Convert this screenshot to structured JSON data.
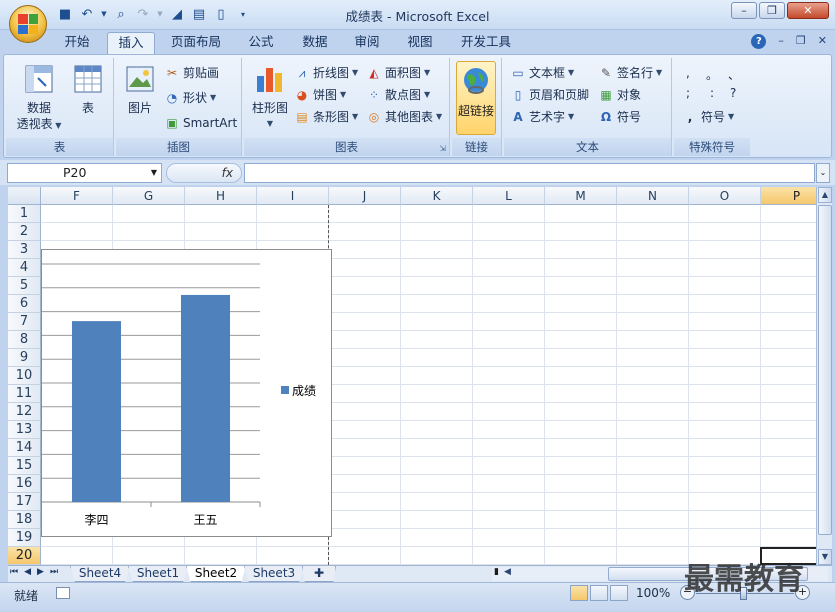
{
  "window": {
    "title": "成绩表 - Microsoft Excel"
  },
  "tabs": [
    "开始",
    "插入",
    "页面布局",
    "公式",
    "数据",
    "审阅",
    "视图",
    "开发工具"
  ],
  "active_tab": "插入",
  "ribbon": {
    "tables": {
      "label": "表",
      "pivot_line1": "数据",
      "pivot_line2": "透视表",
      "table": "表"
    },
    "illustrations": {
      "label": "插图",
      "picture": "图片",
      "clipart": "剪贴画",
      "shapes": "形状",
      "smartart": "SmartArt"
    },
    "charts": {
      "label": "图表",
      "column": "柱形图",
      "line": "折线图",
      "pie": "饼图",
      "bar": "条形图",
      "area": "面积图",
      "scatter": "散点图",
      "other": "其他图表"
    },
    "links": {
      "label": "链接",
      "hyperlink": "超链接"
    },
    "text": {
      "label": "文本",
      "textbox": "文本框",
      "header_footer": "页眉和页脚",
      "wordart": "艺术字",
      "signature": "签名行",
      "object": "对象",
      "symbol": "符号"
    },
    "special": {
      "label": "特殊符号",
      "symbols": [
        ",",
        "。",
        "、",
        ";",
        ":",
        "?"
      ],
      "symbol_button": "符号"
    }
  },
  "formula_bar": {
    "name_box": "P20",
    "fx": "fx",
    "formula": ""
  },
  "columns": [
    "F",
    "G",
    "H",
    "I",
    "J",
    "K",
    "L",
    "M",
    "N",
    "O",
    "P"
  ],
  "selected_column": "P",
  "rows": [
    "1",
    "2",
    "3",
    "4",
    "5",
    "6",
    "7",
    "8",
    "9",
    "10",
    "11",
    "12",
    "13",
    "14",
    "15",
    "16",
    "17",
    "18",
    "19",
    "20"
  ],
  "selected_row": "20",
  "chart_data": {
    "type": "bar",
    "categories": [
      "李四",
      "王五"
    ],
    "series": [
      {
        "name": "成绩",
        "values": [
          76,
          87
        ]
      }
    ],
    "ylim": [
      0,
      100
    ],
    "gridlines": true,
    "legend_position": "right",
    "colors": {
      "bar": "#4f81bd"
    }
  },
  "sheets": [
    "Sheet4",
    "Sheet1",
    "Sheet2",
    "Sheet3"
  ],
  "active_sheet": "Sheet2",
  "status": {
    "ready": "就绪",
    "zoom": "100%"
  },
  "watermark": "最需教育"
}
